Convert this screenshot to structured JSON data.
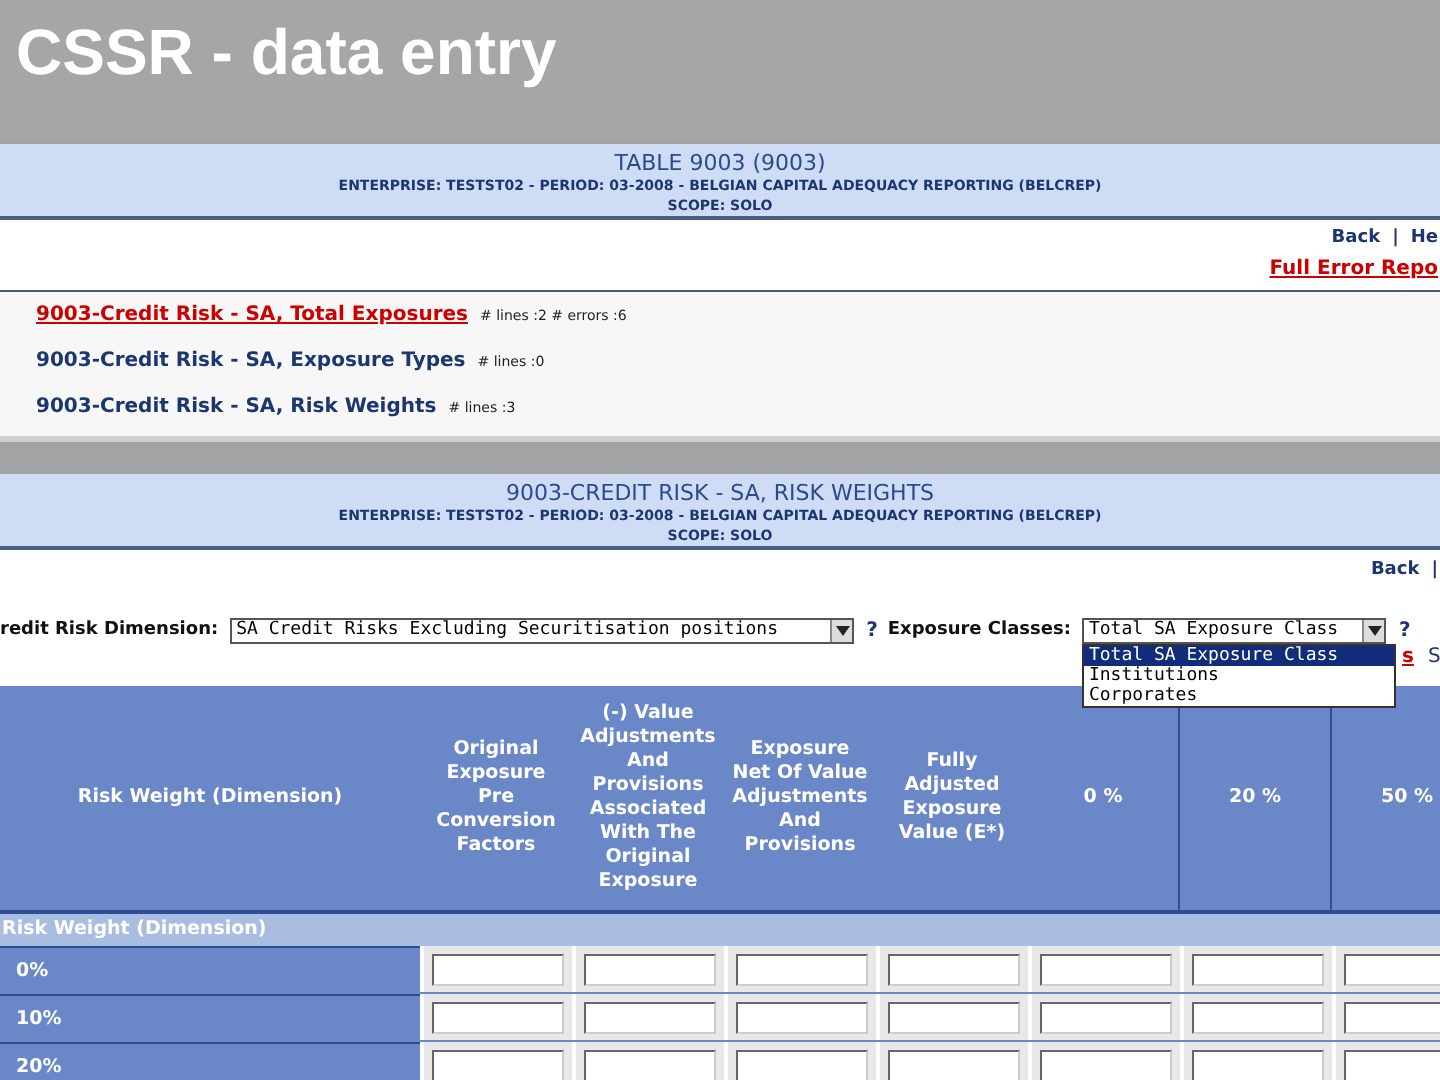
{
  "slide_title": "CSSR - data entry",
  "panel_1": {
    "title": "TABLE 9003 (9003)",
    "subtitle": "ENTERPRISE: TESTST02 - PERIOD: 03-2008 - BELGIAN CAPITAL ADEQUACY REPORTING (BELCREP)",
    "scope": "SCOPE: SOLO",
    "nav": [
      "Back",
      "|",
      "He"
    ],
    "error_link": "Full Error Repo",
    "items": [
      {
        "link": "9003-Credit Risk - SA, Total Exposures",
        "info": "# lines :2  # errors :6",
        "has_errors": true
      },
      {
        "link": "9003-Credit Risk - SA, Exposure Types",
        "info": "# lines :0",
        "has_errors": false
      },
      {
        "link": "9003-Credit Risk - SA, Risk Weights",
        "info": "# lines :3",
        "has_errors": false
      }
    ]
  },
  "panel_2": {
    "title": "9003-CREDIT RISK - SA, RISK WEIGHTS",
    "subtitle": "ENTERPRISE: TESTST02 - PERIOD: 03-2008 - BELGIAN CAPITAL ADEQUACY REPORTING (BELCREP)",
    "scope": "SCOPE: SOLO",
    "nav": [
      "Back",
      "|"
    ],
    "filters": [
      {
        "label": "redit Risk Dimension:",
        "value": "SA Credit Risks Excluding Securitisation positions",
        "help": "?"
      },
      {
        "label": "Exposure Classes:",
        "value": "Total SA Exposure Class",
        "help": "?",
        "expanded": true,
        "options": [
          {
            "label": "Total SA Exposure Class",
            "selected": true
          },
          {
            "label": "Institutions",
            "selected": false
          },
          {
            "label": "Corporates",
            "selected": false
          }
        ]
      }
    ],
    "hidden_links": [
      "s",
      "S"
    ],
    "table": {
      "columns": [
        "Risk Weight (Dimension)",
        "Original Exposure Pre Conversion Factors",
        "(-) Value Adjustments And Provisions Associated With The Original Exposure",
        "Exposure Net Of Value Adjustments And Provisions",
        "Fully Adjusted Exposure Value (E*)",
        "0 %",
        "20 %",
        "50 %"
      ],
      "group_label": "Risk Weight (Dimension)",
      "rows": [
        {
          "label": "0%"
        },
        {
          "label": "10%"
        },
        {
          "label": "20%"
        }
      ]
    }
  }
}
